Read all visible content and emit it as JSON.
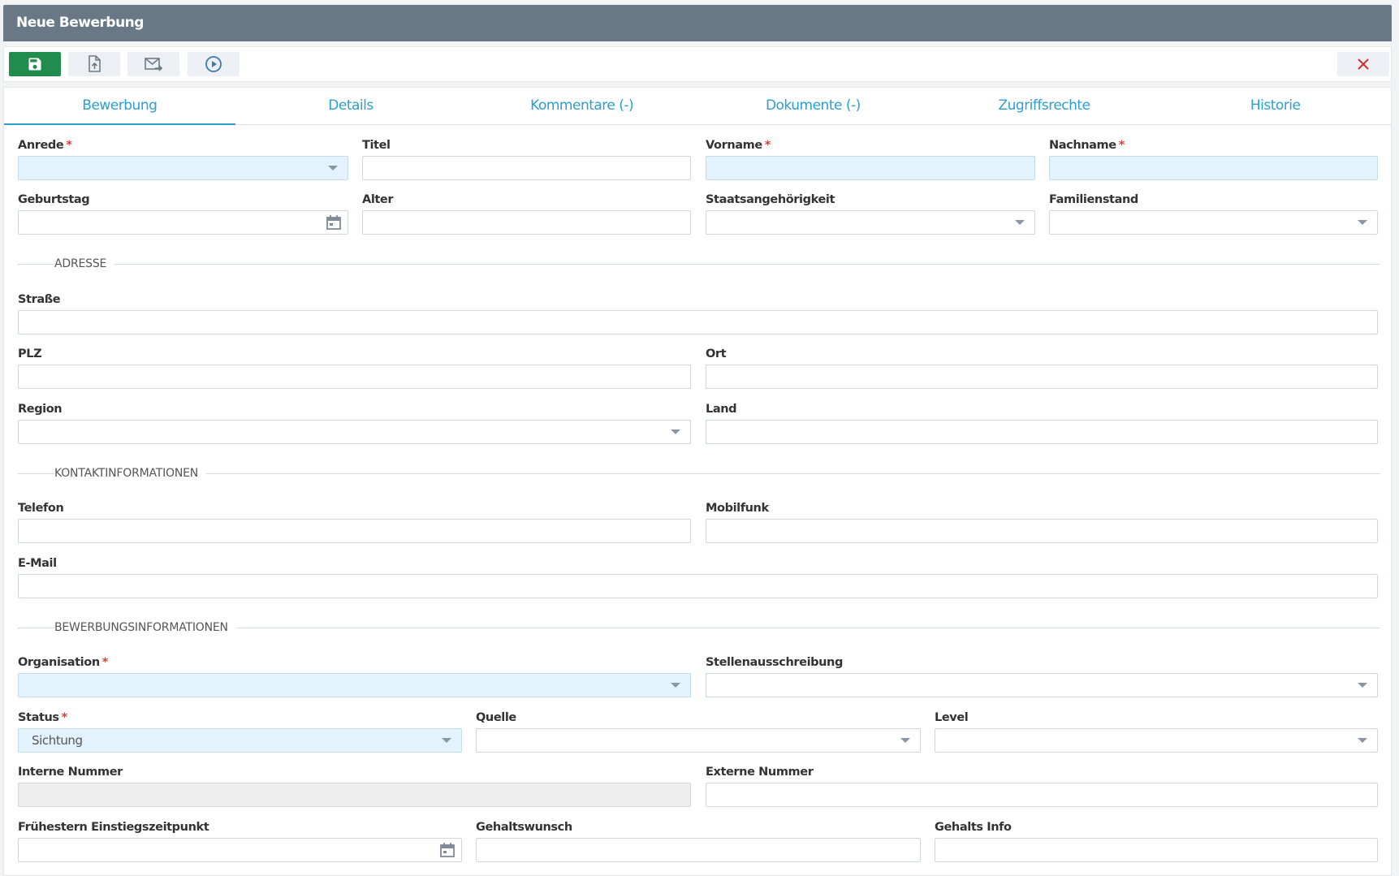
{
  "window": {
    "title": "Neue Bewerbung"
  },
  "toolbar": {
    "buttons": [
      {
        "name": "save",
        "icon": "floppy-disk-icon"
      },
      {
        "name": "upload",
        "icon": "file-upload-icon"
      },
      {
        "name": "send-mail",
        "icon": "mail-forward-icon"
      },
      {
        "name": "play",
        "icon": "play-circle-icon"
      },
      {
        "name": "close",
        "icon": "close-icon"
      }
    ],
    "save_color": "#228b4e",
    "close_color": "#d32f2f"
  },
  "tabs": [
    {
      "label": "Bewerbung",
      "active": true
    },
    {
      "label": "Details"
    },
    {
      "label": "Kommentare (-)"
    },
    {
      "label": "Dokumente (-)"
    },
    {
      "label": "Zugriffsrechte"
    },
    {
      "label": "Historie"
    }
  ],
  "form": {
    "anrede": {
      "label": "Anrede",
      "required": "*",
      "value": ""
    },
    "titel": {
      "label": "Titel",
      "value": ""
    },
    "vorname": {
      "label": "Vorname",
      "required": "*",
      "value": ""
    },
    "nachname": {
      "label": "Nachname",
      "required": "*",
      "value": ""
    },
    "geburtstag": {
      "label": "Geburtstag",
      "value": ""
    },
    "alter": {
      "label": "Alter",
      "value": ""
    },
    "staatsangehoerigkeit": {
      "label": "Staatsangehörigkeit",
      "value": ""
    },
    "familienstand": {
      "label": "Familienstand",
      "value": ""
    },
    "adresse_section": "ADRESSE",
    "strasse": {
      "label": "Straße",
      "value": ""
    },
    "plz": {
      "label": "PLZ",
      "value": ""
    },
    "ort": {
      "label": "Ort",
      "value": ""
    },
    "region": {
      "label": "Region",
      "value": ""
    },
    "land": {
      "label": "Land",
      "value": ""
    },
    "kontakt_section": "KONTAKTINFORMATIONEN",
    "telefon": {
      "label": "Telefon",
      "value": ""
    },
    "mobilfunk": {
      "label": "Mobilfunk",
      "value": ""
    },
    "email": {
      "label": "E-Mail",
      "value": ""
    },
    "bewerbung_section": "BEWERBUNGSINFORMATIONEN",
    "organisation": {
      "label": "Organisation",
      "required": "*",
      "value": ""
    },
    "stellenausschreibung": {
      "label": "Stellenausschreibung",
      "value": ""
    },
    "status": {
      "label": "Status",
      "required": "*",
      "value": "Sichtung"
    },
    "quelle": {
      "label": "Quelle",
      "value": ""
    },
    "level": {
      "label": "Level",
      "value": ""
    },
    "interne_nummer": {
      "label": "Interne Nummer",
      "value": ""
    },
    "externe_nummer": {
      "label": "Externe Nummer",
      "value": ""
    },
    "einstieg": {
      "label": "Frühestern Einstiegszeitpunkt",
      "value": ""
    },
    "gehaltswunsch": {
      "label": "Gehaltswunsch",
      "value": ""
    },
    "gehalts_info": {
      "label": "Gehalts Info",
      "value": ""
    }
  },
  "colors": {
    "header_bg": "#687887",
    "tab_text": "#2a9fd0",
    "required_field_bg": "#e3f3fd",
    "required_star": "#e53935"
  }
}
